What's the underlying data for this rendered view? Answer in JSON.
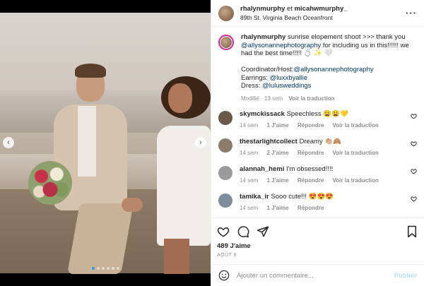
{
  "post": {
    "header": {
      "user1": "rhalynmurphy",
      "joiner": "et",
      "user2": "micahwmurphy_",
      "location": "89th St. Virginia Beach Oceanfront",
      "more_icon": "more-horizontal-icon"
    },
    "caption": {
      "username": "rhalynmurphy",
      "text_part1": "sunrise elopement shoot >>> thank you",
      "mention1": "@allysonannephotography",
      "text_part2": "for including us in this!!!!!! we had the best time!!!!! 💍 ✨ 🤍",
      "coordinator_label": "Coordinator/Host:",
      "coordinator_mention": "@allysonannephotography",
      "earrings_label": "Earrings:",
      "earrings_mention": "@luxxbyallie",
      "dress_label": "Dress:",
      "dress_mention": "@lulusweddings",
      "modified": "Modifié · 13 sem",
      "translate": "Voir la traduction"
    },
    "comments": [
      {
        "username": "skymckissack",
        "text": "Speechless 😩😩💛",
        "age": "14 sem",
        "likes": "1 J'aime",
        "reply": "Répondre",
        "translate": "Voir la traduction",
        "avatar_color": "#6b5a4a"
      },
      {
        "username": "thestarlightcollect",
        "text": "Dreamy 👏🏼🙈",
        "age": "14 sem",
        "likes": "2 J'aime",
        "reply": "Répondre",
        "translate": "Voir la traduction",
        "avatar_color": "#8a7b6a"
      },
      {
        "username": "alannah_hemi",
        "text": "I'm obsessed!!!!",
        "age": "14 sem",
        "likes": "1 J'aime",
        "reply": "Répondre",
        "translate": "Voir la traduction",
        "avatar_color": "#9a9a9a"
      },
      {
        "username": "tamika_ir",
        "text": "Sooo cute!!! 😍😍😍",
        "age": "14 sem",
        "likes": "1 J'aime",
        "reply": "Répondre",
        "translate": "",
        "avatar_color": "#7d8e9a"
      }
    ],
    "likes_count": "489 J'aime",
    "date": "AOÛT 8",
    "add_comment": {
      "placeholder": "Ajouter un commentaire...",
      "post_label": "Publier",
      "emoji_icon": "emoji-icon"
    },
    "carousel": {
      "prev_icon": "chevron-left-icon",
      "next_icon": "chevron-right-icon",
      "slide_count": 6,
      "active_slide": 1
    },
    "colors": {
      "link": "#00376b",
      "muted": "#8e8e8e",
      "publish_disabled": "#b2dffc",
      "story_ring": "#d6249f"
    }
  }
}
